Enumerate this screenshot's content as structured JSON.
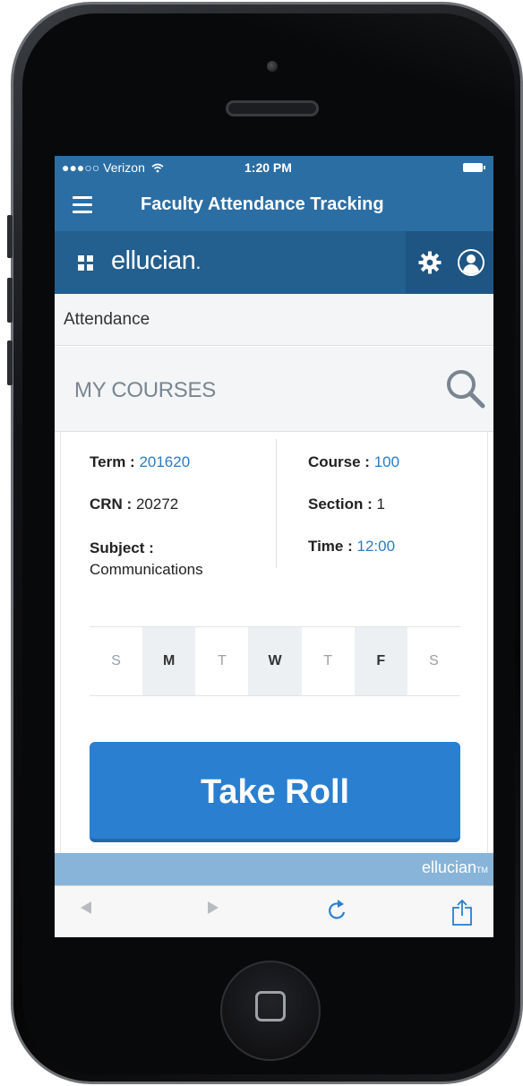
{
  "status_bar": {
    "carrier": "●●●○○ Verizon",
    "wifi_icon": "wifi-icon",
    "time": "1:20 PM",
    "battery_icon": "battery-icon"
  },
  "app_bar": {
    "title": "Faculty Attendance Tracking",
    "menu_icon": "menu-icon"
  },
  "brand_bar": {
    "logo_text": "ellucian",
    "logo_suffix": ".",
    "settings_icon": "gear-icon",
    "profile_icon": "user-icon"
  },
  "breadcrumb": "Attendance",
  "courses": {
    "title": "MY COURSES",
    "search_icon": "search-icon"
  },
  "course_card": {
    "term_label": "Term :",
    "term_value": "201620",
    "crn_label": "CRN :",
    "crn_value": "20272",
    "subject_label": "Subject :",
    "subject_value": "Communications",
    "course_label": "Course :",
    "course_value": "100",
    "section_label": "Section :",
    "section_value": "1",
    "time_label": "Time :",
    "time_value": "12:00",
    "days": [
      {
        "label": "S",
        "active": false
      },
      {
        "label": "M",
        "active": true
      },
      {
        "label": "T",
        "active": false
      },
      {
        "label": "W",
        "active": true
      },
      {
        "label": "T",
        "active": false
      },
      {
        "label": "F",
        "active": true
      },
      {
        "label": "S",
        "active": false
      }
    ],
    "take_roll_label": "Take Roll"
  },
  "footer": {
    "brand": "ellucian",
    "tm": "TM"
  },
  "browser": {
    "back_icon": "back-arrow-icon",
    "forward_icon": "forward-arrow-icon",
    "reload_icon": "reload-icon",
    "share_icon": "share-icon"
  },
  "colors": {
    "header_blue": "#2b6ea4",
    "brand_bar_blue": "#235f8f",
    "accent_blue": "#2a7fd0",
    "link_blue": "#2b7bc0",
    "footer_strip": "#87b4d8"
  }
}
